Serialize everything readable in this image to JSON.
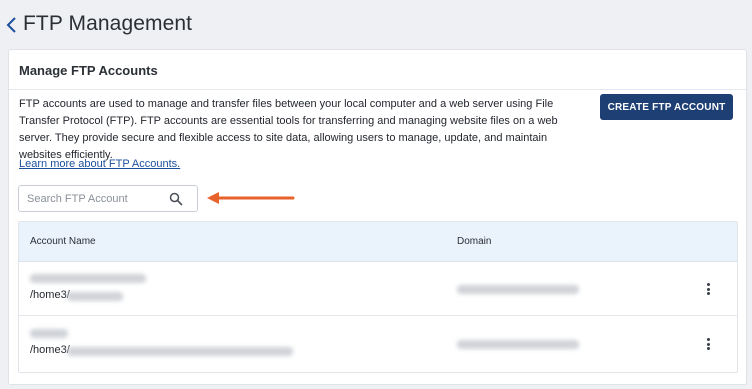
{
  "header": {
    "title": "FTP Management"
  },
  "card": {
    "title": "Manage FTP Accounts",
    "description": "FTP accounts are used to manage and transfer files between your local computer and a web server using File Transfer Protocol (FTP). FTP accounts are essential tools for transferring and managing website files on a web server. They provide secure and flexible access to site data, allowing users to manage, update, and maintain websites efficiently.",
    "learn_more": "Learn more about FTP Accounts.",
    "create_button": "CREATE FTP ACCOUNT"
  },
  "search": {
    "placeholder": "Search FTP Account"
  },
  "table": {
    "columns": [
      "Account Name",
      "Domain"
    ],
    "rows": [
      {
        "path": "/home3/"
      },
      {
        "path": "/home3/"
      }
    ]
  },
  "colors": {
    "accent": "#1d3f73",
    "link": "#1c4f9c",
    "annotation_arrow": "#e8622b",
    "table_header_bg": "#eaf2fb",
    "page_bg": "#eef0f3"
  }
}
